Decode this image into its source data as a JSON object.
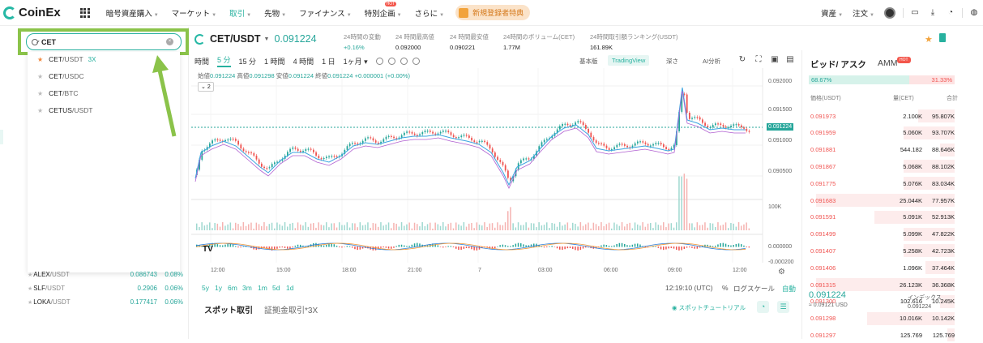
{
  "nav": {
    "logo": "CoinEx",
    "items": [
      "暗号資産購入",
      "マーケット",
      "取引",
      "先物",
      "ファイナンス",
      "特別企画",
      "さらに"
    ],
    "hot_badge": "HOT",
    "promo": "新規登録者特典",
    "right": [
      "資産",
      "注文"
    ]
  },
  "search": {
    "value": "CET"
  },
  "dropdown": [
    {
      "base": "CET",
      "quote": "/USDT",
      "lev": "3X",
      "fav": true
    },
    {
      "base": "CET",
      "quote": "/USDC",
      "lev": "",
      "fav": false
    },
    {
      "base": "CET",
      "quote": "/BTC",
      "lev": "",
      "fav": false
    },
    {
      "base": "CETUS",
      "quote": "/USDT",
      "lev": "",
      "fav": false
    }
  ],
  "tickers": [
    {
      "base": "ALEX",
      "quote": "/USDT",
      "price": "0.086743",
      "change": "0.08%"
    },
    {
      "base": "SLF",
      "quote": "/USDT",
      "price": "0.2906",
      "change": "0.06%"
    },
    {
      "base": "LOKA",
      "quote": "/USDT",
      "price": "0.177417",
      "change": "0.06%"
    }
  ],
  "pair": {
    "name": "CET/USDT",
    "price": "0.091224"
  },
  "stats": [
    {
      "label": "24時間の変動",
      "value": "+0.16%"
    },
    {
      "label": "24 時間最高値",
      "value": "0.092000"
    },
    {
      "label": "24 時間最安値",
      "value": "0.090221"
    },
    {
      "label": "24時間のボリューム(CET)",
      "value": "1.77M"
    },
    {
      "label": "24時間取引額ランキング(USDT)",
      "value": "161.89K"
    }
  ],
  "toolbar": {
    "timeframes": [
      "時間",
      "5 分",
      "15 分",
      "1 時間",
      "4 時間",
      "1 日",
      "1ヶ月 ▾"
    ],
    "active": "5 分",
    "views": [
      "基本版",
      "TradingView",
      "深さ",
      "AI分析"
    ]
  },
  "ohlc": {
    "o_label": "始値",
    "o": "0.091224",
    "h_label": "高値",
    "h": "0.091298",
    "l_label": "安値",
    "l": "0.091224",
    "c_label": "終値",
    "c": "0.091224",
    "chg": "+0.000001 (+0.00%)"
  },
  "collapse": "2",
  "chart": {
    "y_ticks": [
      "0.092000",
      "0.091500",
      "0.091000",
      "0.090500"
    ],
    "price_tag": "0.091224",
    "vol_tick": "100K",
    "osc_ticks": [
      "0.000000",
      "-0.000200"
    ],
    "x_ticks": [
      "12:00",
      "15:00",
      "18:00",
      "21:00",
      "7",
      "03:00",
      "06:00",
      "09:00",
      "12:00"
    ],
    "tv_logo": "TV"
  },
  "ranges": [
    "5y",
    "1y",
    "6m",
    "3m",
    "1m",
    "5d",
    "1d"
  ],
  "bottom": {
    "time": "12:19:10 (UTC)",
    "pct": "%",
    "log": "ログスケール",
    "auto": "自動"
  },
  "spot_tabs": [
    "スポット取引",
    "証拠金取引*3X"
  ],
  "tutorial": "スポットチュートリアル",
  "orderbook": {
    "tabs": [
      "ビッド/ アスク",
      "AMM"
    ],
    "hot": "HOT",
    "buy_ratio": "68.67%",
    "sell_ratio": "31.33%",
    "headers": [
      "価格(USDT)",
      "量(CET)",
      "合計"
    ],
    "rows": [
      {
        "price": "0.091973",
        "amount": "2.100K",
        "total": "95.807K",
        "depth": 0.25
      },
      {
        "price": "0.091959",
        "amount": "5.060K",
        "total": "93.707K",
        "depth": 0.35
      },
      {
        "price": "0.091881",
        "amount": "544.182",
        "total": "88.646K",
        "depth": 0.1
      },
      {
        "price": "0.091867",
        "amount": "5.068K",
        "total": "88.102K",
        "depth": 0.35
      },
      {
        "price": "0.091775",
        "amount": "5.076K",
        "total": "83.034K",
        "depth": 0.35
      },
      {
        "price": "0.091683",
        "amount": "25.044K",
        "total": "77.957K",
        "depth": 0.95
      },
      {
        "price": "0.091591",
        "amount": "5.091K",
        "total": "52.913K",
        "depth": 0.55
      },
      {
        "price": "0.091499",
        "amount": "5.099K",
        "total": "47.822K",
        "depth": 0.35
      },
      {
        "price": "0.091407",
        "amount": "5.258K",
        "total": "42.723K",
        "depth": 0.35
      },
      {
        "price": "0.091406",
        "amount": "1.096K",
        "total": "37.464K",
        "depth": 0.2
      },
      {
        "price": "0.091315",
        "amount": "26.123K",
        "total": "36.368K",
        "depth": 0.95
      },
      {
        "price": "0.091300",
        "amount": "102.616",
        "total": "10.245K",
        "depth": 0.1
      },
      {
        "price": "0.091298",
        "amount": "10.016K",
        "total": "10.142K",
        "depth": 0.6
      },
      {
        "price": "0.091297",
        "amount": "125.769",
        "total": "125.769",
        "depth": 0.05
      }
    ],
    "last": "0.091224",
    "approx": "≈ 0.09121 USD",
    "index_label": "インデックス",
    "index_value": "0.091224"
  }
}
